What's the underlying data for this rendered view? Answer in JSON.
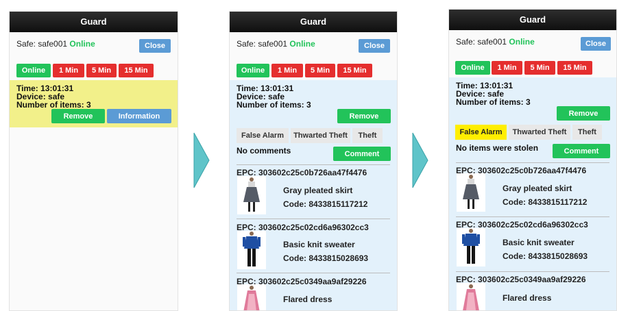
{
  "app_title": "Guard",
  "safe_label": "Safe: safe001",
  "online_status": "Online",
  "close_label": "Close",
  "filters": [
    "Online",
    "1 Min",
    "5 Min",
    "15 Min"
  ],
  "alert": {
    "time": "Time: 13:01:31",
    "device": "Device: safe",
    "items": "Number of items: 3"
  },
  "remove_label": "Remove",
  "information_label": "Information",
  "comment_label": "Comment",
  "tags": [
    "False Alarm",
    "Thwarted Theft",
    "Theft"
  ],
  "comments": {
    "panel2": "No comments",
    "panel3": "No items were stolen"
  },
  "items": [
    {
      "epc": "EPC: 303602c25c0b726aa47f4476",
      "name": "Gray pleated skirt",
      "code": "Code: 8433815117212"
    },
    {
      "epc": "EPC: 303602c25c02cd6a96302cc3",
      "name": "Basic knit sweater",
      "code": "Code: 8433815028693"
    },
    {
      "epc": "EPC: 303602c25c0349aa9af29226",
      "name": "Flared dress",
      "code": ""
    }
  ],
  "colors": {
    "online": "#22c35a",
    "red": "#e52e2e",
    "blue": "#5b9bd5",
    "alert_yellow": "#f2f08a",
    "alert_blue": "#e3f1fb",
    "selected_tag": "#ffee00",
    "arrow": "#5fc4c9"
  }
}
